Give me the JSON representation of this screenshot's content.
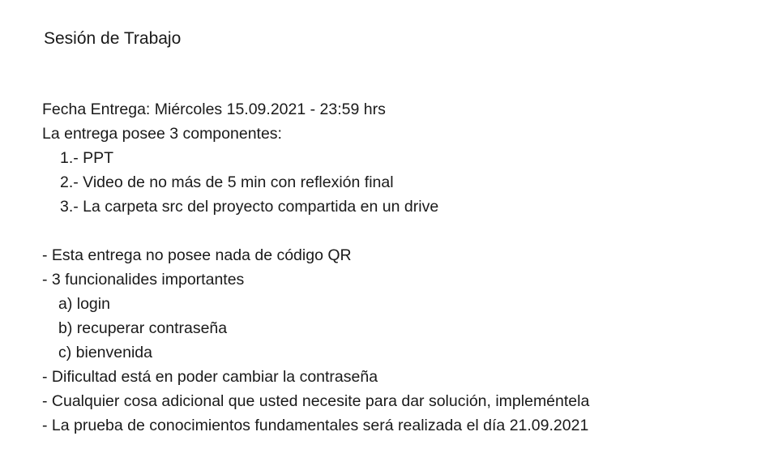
{
  "title": "Sesión de Trabajo",
  "delivery": {
    "date_line": "Fecha Entrega: Miércoles 15.09.2021 - 23:59 hrs",
    "components_intro": "La entrega posee 3 componentes:",
    "components": [
      "1.- PPT",
      "2.- Video de no más de 5 min con reflexión final",
      "3.- La carpeta src del proyecto compartida en un drive"
    ]
  },
  "notes": {
    "no_qr": "- Esta entrega no posee nada de código QR",
    "functionalities_intro": "- 3 funcionalides importantes",
    "functionalities": [
      "a) login",
      "b) recuperar contraseña",
      "c) bienvenida"
    ],
    "difficulty": "- Dificultad está en poder cambiar la contraseña",
    "additional": "- Cualquier cosa adicional que usted necesite para dar solución, impleméntela",
    "exam": "- La prueba de conocimientos fundamentales será realizada el día 21.09.2021"
  }
}
